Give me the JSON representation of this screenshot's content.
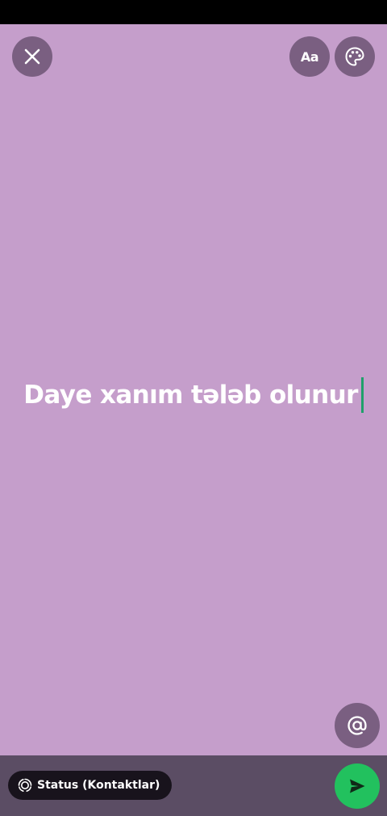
{
  "composer": {
    "status_text": "Daye xanım tələb olunur",
    "background_color": "#c59ecb",
    "caret_color": "#1fa06a"
  },
  "toolbar": {
    "close_icon": "close-icon",
    "font_button_label": "Aa",
    "palette_icon": "palette-icon"
  },
  "mention": {
    "icon": "at-sign-icon",
    "label": "@"
  },
  "footer": {
    "privacy_label": "Status (Kontaktlar)",
    "privacy_icon": "status-ring-icon",
    "send_icon": "send-icon",
    "send_color": "#22c15e"
  }
}
